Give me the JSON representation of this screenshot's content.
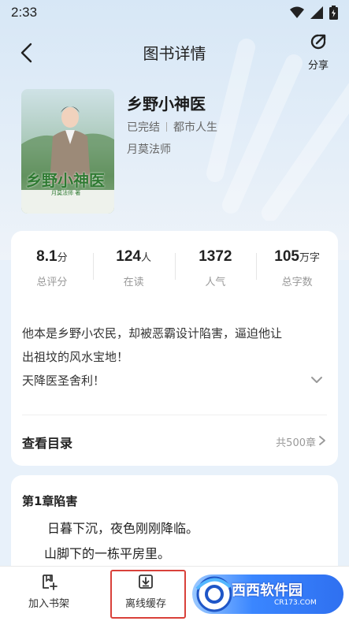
{
  "status_bar": {
    "time": "2:33"
  },
  "header": {
    "title": "图书详情",
    "share_label": "分享"
  },
  "book": {
    "title": "乡野小神医",
    "status": "已完结",
    "category": "都市人生",
    "author": "月莫法师",
    "cover_title": "乡野小神医",
    "cover_sub": "月莫法师 著"
  },
  "stats": [
    {
      "value": "8.1",
      "unit": "分",
      "label": "总评分"
    },
    {
      "value": "124",
      "unit": "人",
      "label": "在读"
    },
    {
      "value": "1372",
      "unit": "",
      "label": "人气"
    },
    {
      "value": "105",
      "unit": "万字",
      "label": "总字数"
    }
  ],
  "description": {
    "line1": "他本是乡野小农民，却被恶霸设计陷害，逼迫他让",
    "line2": "出祖坟的风水宝地！",
    "line3": "天降医圣舍利！"
  },
  "toc": {
    "label": "查看目录",
    "count": "共500章"
  },
  "chapter": {
    "title": "第1章陷害",
    "line1": "日暮下沉，夜色刚刚降临。",
    "line2": "山脚下的一栋平房里。"
  },
  "bottom_bar": {
    "add_shelf": "加入书架",
    "offline_cache": "离线缓存"
  },
  "watermark": {
    "text": "西西软件园",
    "sub": "CR173.COM"
  },
  "colors": {
    "highlight": "#d9413a",
    "accent": "#3a86ff",
    "background": "#e8f1fa"
  }
}
